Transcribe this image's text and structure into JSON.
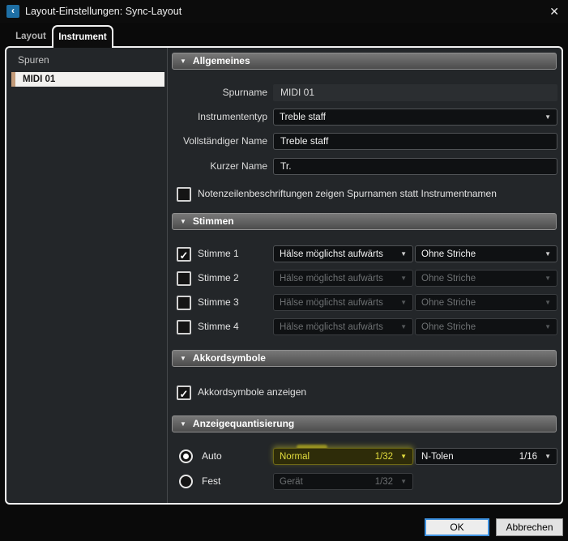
{
  "window": {
    "title": "Layout-Einstellungen: Sync-Layout"
  },
  "icons": {
    "app": "‹",
    "close": "✕",
    "chevron_down": "▼",
    "collapse": "▼",
    "check": "✓"
  },
  "tabs": {
    "layout": "Layout",
    "instrument": "Instrument"
  },
  "sidebar": {
    "header": "Spuren",
    "tracks": [
      {
        "label": "MIDI 01",
        "color": "#c39b79",
        "selected": true
      }
    ]
  },
  "general": {
    "title": "Allgemeines",
    "track_name_label": "Spurname",
    "track_name_value": "MIDI 01",
    "instrument_type_label": "Instrumententyp",
    "instrument_type_value": "Treble staff",
    "full_name_label": "Vollständiger Name",
    "full_name_value": "Treble staff",
    "short_name_label": "Kurzer Name",
    "short_name_value": "Tr.",
    "staff_labels_checkbox": "Notenzeilenbeschriftungen zeigen Spurnamen statt Instrumentnamen",
    "staff_labels_checked": false
  },
  "voices": {
    "title": "Stimmen",
    "rows": [
      {
        "label": "Stimme 1",
        "checked": true,
        "enabled": true,
        "stems": "Hälse möglichst aufwärts",
        "beams": "Ohne Striche"
      },
      {
        "label": "Stimme 2",
        "checked": false,
        "enabled": false,
        "stems": "Hälse möglichst aufwärts",
        "beams": "Ohne Striche"
      },
      {
        "label": "Stimme 3",
        "checked": false,
        "enabled": false,
        "stems": "Hälse möglichst aufwärts",
        "beams": "Ohne Striche"
      },
      {
        "label": "Stimme 4",
        "checked": false,
        "enabled": false,
        "stems": "Hälse möglichst aufwärts",
        "beams": "Ohne Striche"
      }
    ]
  },
  "chords": {
    "title": "Akkordsymbole",
    "show_label": "Akkordsymbole anzeigen",
    "show_checked": true
  },
  "quantize": {
    "title": "Anzeigequantisierung",
    "auto_label": "Auto",
    "auto_selected": true,
    "auto_mode": "Normal",
    "auto_value": "1/32",
    "tuplets_mode": "N-Tolen",
    "tuplets_value": "1/16",
    "fixed_label": "Fest",
    "fixed_selected": false,
    "fixed_mode": "Gerät",
    "fixed_value": "1/32"
  },
  "footer": {
    "ok": "OK",
    "cancel": "Abbrechen"
  },
  "colors": {
    "highlight_yellow": "#e3dd3e",
    "accent_blue": "#3f92e0",
    "track_color": "#c39b79",
    "panel_bg": "#232629"
  }
}
